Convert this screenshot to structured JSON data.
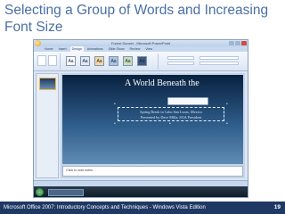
{
  "slide_title": "Selecting a Group of Words and Increasing Font Size",
  "screenshot": {
    "window_title": "Forest Sunset - Microsoft PowerPoint",
    "ribbon_tabs": [
      "Home",
      "Insert",
      "Design",
      "Animations",
      "Slide Show",
      "Review",
      "View"
    ],
    "theme_samples": [
      "Aa",
      "Aa",
      "Aa",
      "Aa",
      "Aa",
      "Aa"
    ],
    "slide": {
      "heading": "A World Beneath the",
      "subtitle_line1": "Spring Break in Cabo San Lucas, Mexico",
      "subtitle_line2": "Presented by Dave Milla, SGA President"
    },
    "notes_placeholder": "Click to add notes"
  },
  "footer": {
    "text": "Microsoft Office 2007: Introductory Concepts and Techniques - Windows Vista Edition",
    "page": "19"
  },
  "colors": {
    "title": "#4a6fa5",
    "footer_bg": "#1f3864"
  }
}
